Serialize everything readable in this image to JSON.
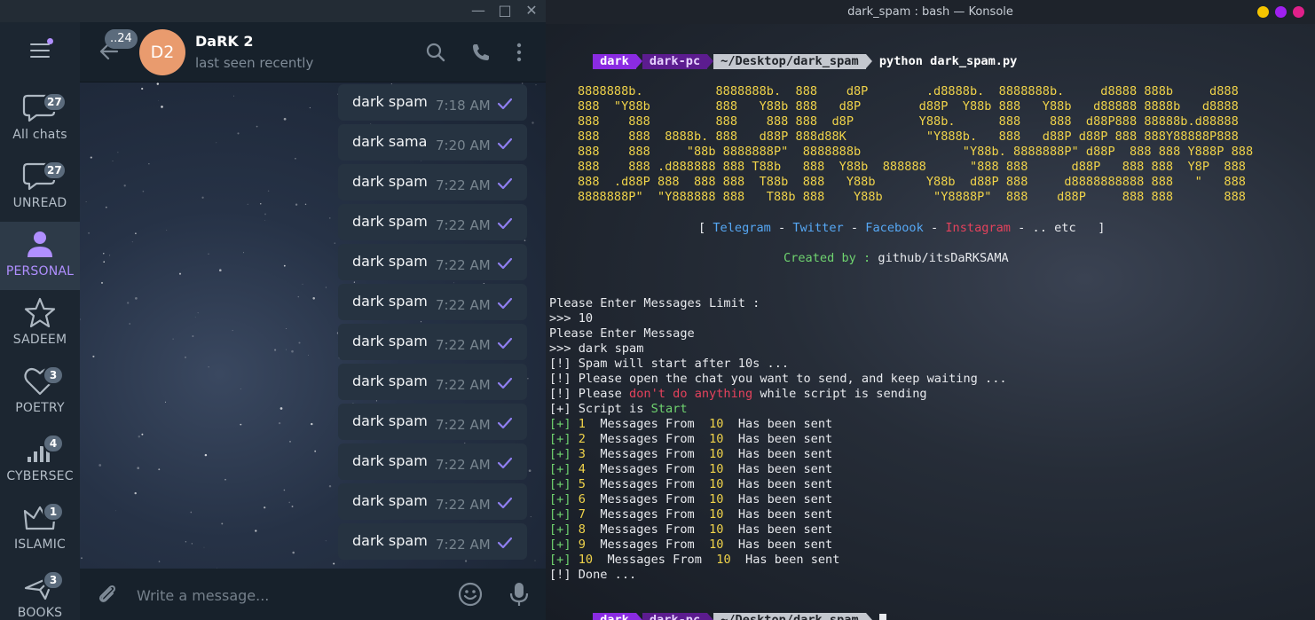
{
  "telegram": {
    "window_buttons": [
      "minimize",
      "maximize",
      "close"
    ],
    "folders": [
      {
        "name": "All chats",
        "badge": "27",
        "icon": "chat-bubble-icon"
      },
      {
        "name": "UNREAD",
        "badge": "27",
        "icon": "chat-bubble-icon"
      },
      {
        "name": "PERSONAL",
        "badge": "",
        "icon": "person-icon",
        "active": true
      },
      {
        "name": "SADEEM",
        "badge": "",
        "icon": "star-icon"
      },
      {
        "name": "POETRY",
        "badge": "3",
        "icon": "heart-icon"
      },
      {
        "name": "CYBERSEC",
        "badge": "4",
        "icon": "signal-bars-icon"
      },
      {
        "name": "ISLAMIC",
        "badge": "1",
        "icon": "crown-icon"
      },
      {
        "name": "BOOKS",
        "badge": "3",
        "icon": "airplane-icon"
      }
    ],
    "header": {
      "unread_count": "..24",
      "avatar_initials": "D2",
      "chat_name": "DaRK 2",
      "status": "last seen recently"
    },
    "messages": [
      {
        "text": "dark spam",
        "time": "7:18 AM"
      },
      {
        "text": "dark sama",
        "time": "7:20 AM"
      },
      {
        "text": "dark spam",
        "time": "7:22 AM"
      },
      {
        "text": "dark spam",
        "time": "7:22 AM"
      },
      {
        "text": "dark spam",
        "time": "7:22 AM"
      },
      {
        "text": "dark spam",
        "time": "7:22 AM"
      },
      {
        "text": "dark spam",
        "time": "7:22 AM"
      },
      {
        "text": "dark spam",
        "time": "7:22 AM"
      },
      {
        "text": "dark spam",
        "time": "7:22 AM"
      },
      {
        "text": "dark spam",
        "time": "7:22 AM"
      },
      {
        "text": "dark spam",
        "time": "7:22 AM"
      },
      {
        "text": "dark spam",
        "time": "7:22 AM"
      }
    ],
    "composer": {
      "placeholder": "Write a message..."
    }
  },
  "konsole": {
    "title": "dark_spam : bash — Konsole",
    "prompt": {
      "user": "dark",
      "host": "dark-pc",
      "path": "~/Desktop/dark_spam"
    },
    "command": "python dark_spam.py",
    "ascii_art": [
      "8888888b.          8888888b.  888    d8P        .d8888b.  8888888b.     d8888 888b     d888",
      "888  \"Y88b         888   Y88b 888   d8P        d88P  Y88b 888   Y88b   d88888 8888b   d8888",
      "888    888         888    888 888  d8P         Y88b.      888    888  d88P888 88888b.d88888",
      "888    888  8888b. 888   d88P 888d88K           \"Y888b.   888   d88P d88P 888 888Y88888P888",
      "888    888     \"88b 8888888P\"  8888888b              \"Y88b. 8888888P\" d88P  888 888 Y888P 888",
      "888    888 .d888888 888 T88b   888  Y88b  888888      \"888 888      d88P   888 888  Y8P  888",
      "888  .d88P 888  888 888  T88b  888   Y88b       Y88b  d88P 888     d8888888888 888   \"   888",
      "8888888P\"  \"Y888888 888   T88b 888    Y88b       \"Y8888P\"  888    d88P     888 888       888"
    ],
    "links": {
      "open": "[ ",
      "telegram": "Telegram",
      "twitter": "Twitter",
      "facebook": "Facebook",
      "instagram": "Instagram",
      "sep": " - ",
      "tail": " - .. etc   ]"
    },
    "credit": {
      "label": "Created by : ",
      "value": "github/itsDaRKSAMA"
    },
    "session": {
      "q1": "Please Enter Messages Limit :",
      "a1": ">>> 10",
      "q2": "Please Enter Message",
      "a2": ">>> dark spam",
      "info1": "[!] Spam will start after 10s ...",
      "info2": "[!] Please open the chat you want to send, and keep waiting ...",
      "info3_pre": "[!] Please ",
      "info3_red": "don't do anything",
      "info3_post": " while script is sending",
      "start_pre": "[+] Script is ",
      "start_word": "Start",
      "sent_total": "10",
      "sent_words_mid": "Messages From",
      "sent_words_end": "Has been sent",
      "done": "[!] Done ..."
    },
    "sent_lines": [
      "1",
      "2",
      "3",
      "4",
      "5",
      "6",
      "7",
      "8",
      "9",
      "10"
    ],
    "window_button_colors": [
      "#f5c400",
      "#a020f0",
      "#e0208a"
    ]
  }
}
